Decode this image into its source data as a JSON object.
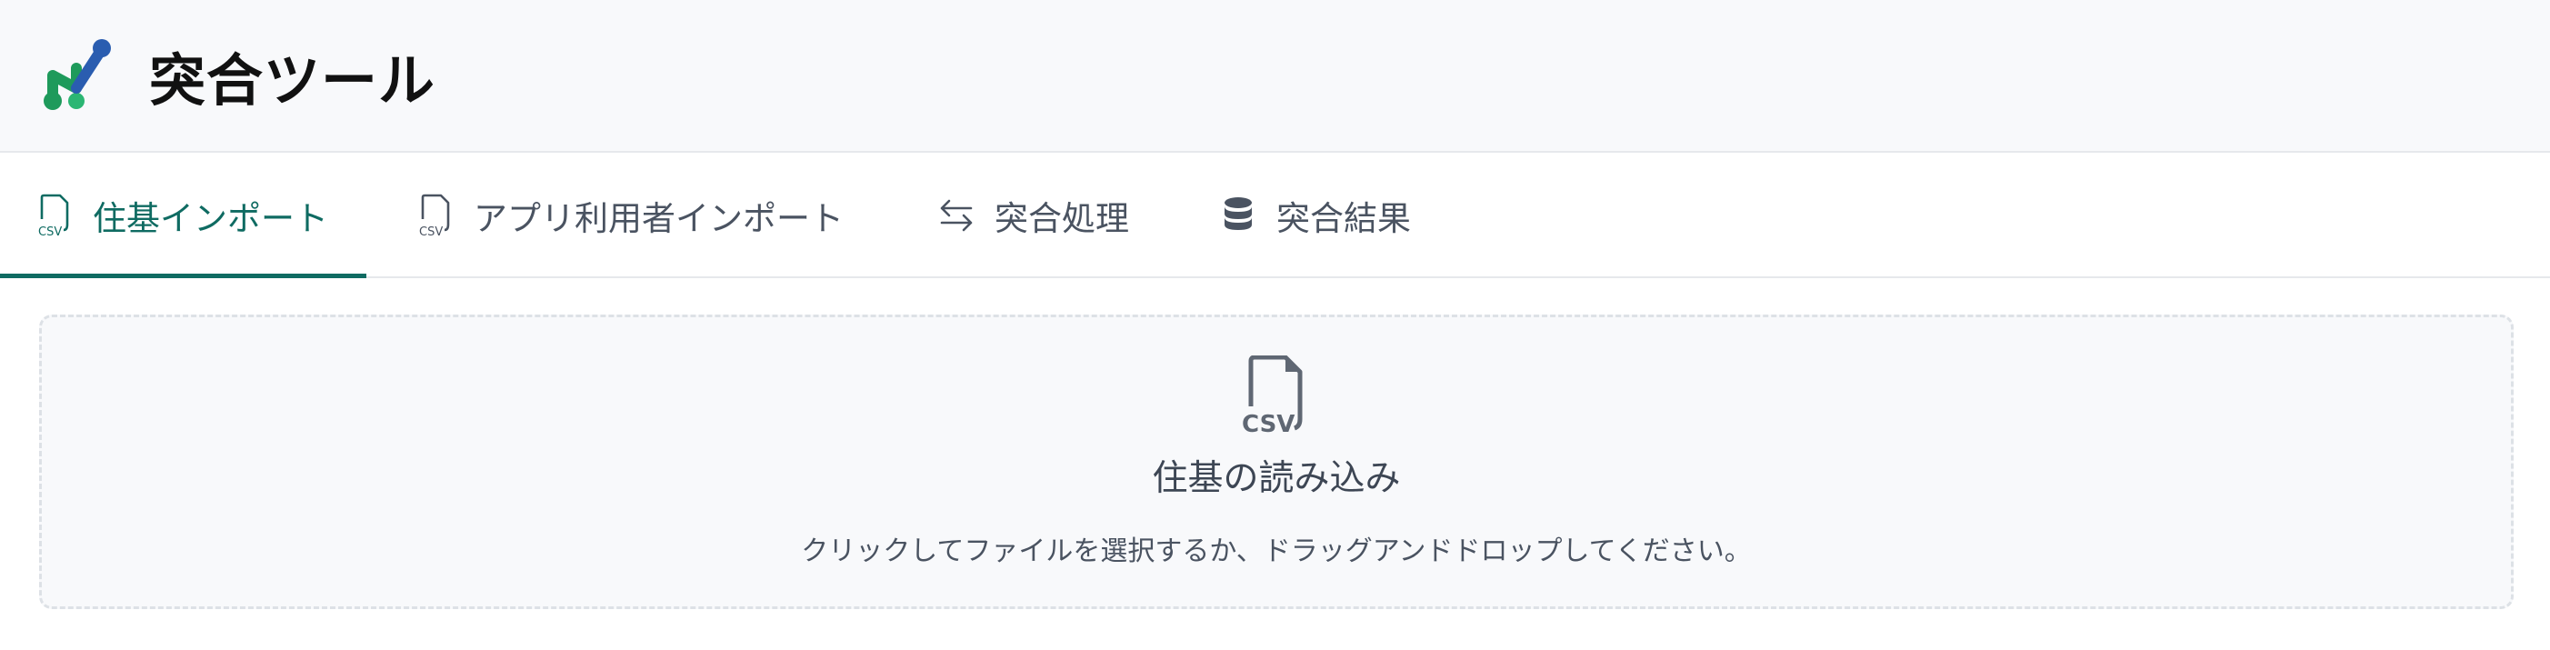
{
  "app": {
    "title": "突合ツール",
    "logo_icon": "app-logo-icon",
    "brand_colors": {
      "green": "#1e9a5b",
      "blue": "#2a5db0",
      "accent": "#0f6b62"
    }
  },
  "tabs": [
    {
      "label": "住基インポート",
      "icon": "csv-file-icon",
      "active": true
    },
    {
      "label": "アプリ利用者インポート",
      "icon": "csv-file-icon",
      "active": false
    },
    {
      "label": "突合処理",
      "icon": "swap-arrows-icon",
      "active": false
    },
    {
      "label": "突合結果",
      "icon": "database-icon",
      "active": false
    }
  ],
  "dropzone": {
    "icon": "csv-file-icon",
    "icon_text": "CSV",
    "title": "住基の読み込み",
    "hint": "クリックしてファイルを選択するか、ドラッグアンドドロップしてください。"
  }
}
